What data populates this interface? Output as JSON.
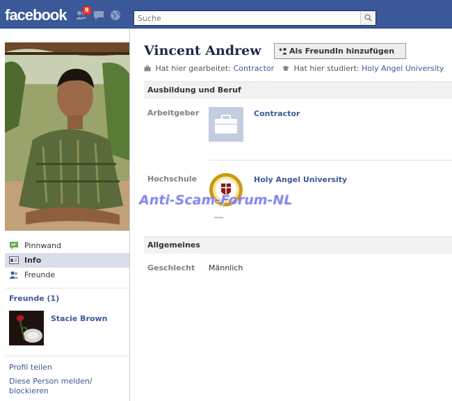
{
  "topbar": {
    "logo": "facebook",
    "notification_count": "9",
    "search_placeholder": "Suche"
  },
  "profile": {
    "name": "Vincent Andrew",
    "add_friend_label": "Als FreundIn hinzufügen",
    "worked_label": "Hat hier gearbeitet:",
    "worked_value": "Contractor",
    "studied_label": "Hat hier studiert:",
    "studied_value": "Holy Angel University"
  },
  "sidebar": {
    "nav": [
      {
        "label": "Pinnwand",
        "icon": "wall-icon"
      },
      {
        "label": "Info",
        "icon": "info-icon"
      },
      {
        "label": "Freunde",
        "icon": "friends-icon"
      }
    ],
    "friends_heading": "Freunde (1)",
    "friend_name": "Stacie Brown",
    "share_profile": "Profil teilen",
    "report_line1": "Diese Person melden/",
    "report_line2": "blockieren"
  },
  "sections": {
    "education": {
      "heading": "Ausbildung und Beruf",
      "employer_label": "Arbeitgeber",
      "employer_name": "Contractor",
      "school_label": "Hochschule",
      "school_name": "Holy Angel University"
    },
    "general": {
      "heading": "Allgemeines",
      "gender_label": "Geschlecht",
      "gender_value": "Männlich"
    }
  },
  "watermark": "Anti-Scam-Forum-NL",
  "colors": {
    "brand_blue": "#3b5998",
    "header_dark": "#1c2a47",
    "watermark": "#7878eb"
  }
}
